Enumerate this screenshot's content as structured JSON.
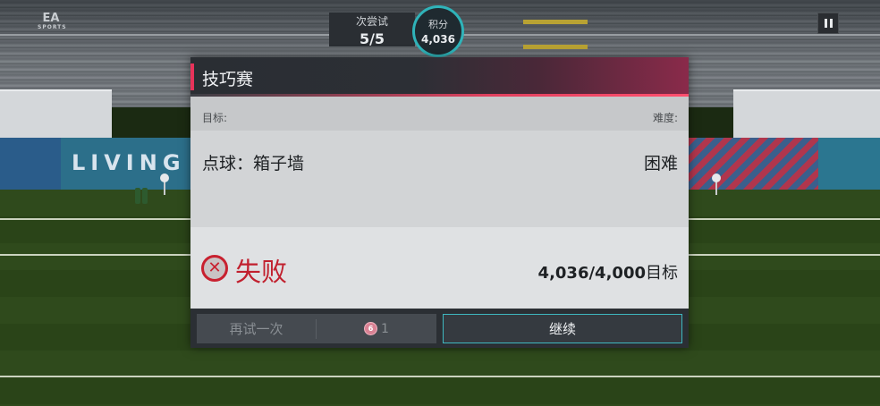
{
  "hud": {
    "logo": "EA",
    "logo_sub": "SPORTS",
    "attempts_label": "次尝试",
    "attempts_value": "5/5",
    "score_label": "积分",
    "score_value": "4,036"
  },
  "background": {
    "ad_text": "LIVING"
  },
  "dialog": {
    "title": "技巧赛",
    "objective_label": "目标:",
    "difficulty_label": "难度:",
    "objective_value": "点球：箱子墙",
    "difficulty_value": "困难",
    "result_text": "失败",
    "result_icon": "fail-x-icon",
    "score_achieved": "4,036/4,000",
    "score_suffix": "目标",
    "retry_label": "再试一次",
    "retry_cost": "1",
    "retry_token_number": "6",
    "continue_label": "继续"
  },
  "colors": {
    "accent_pink": "#e8335a",
    "accent_teal": "#3eb8c0",
    "fail_red": "#c1202e"
  }
}
